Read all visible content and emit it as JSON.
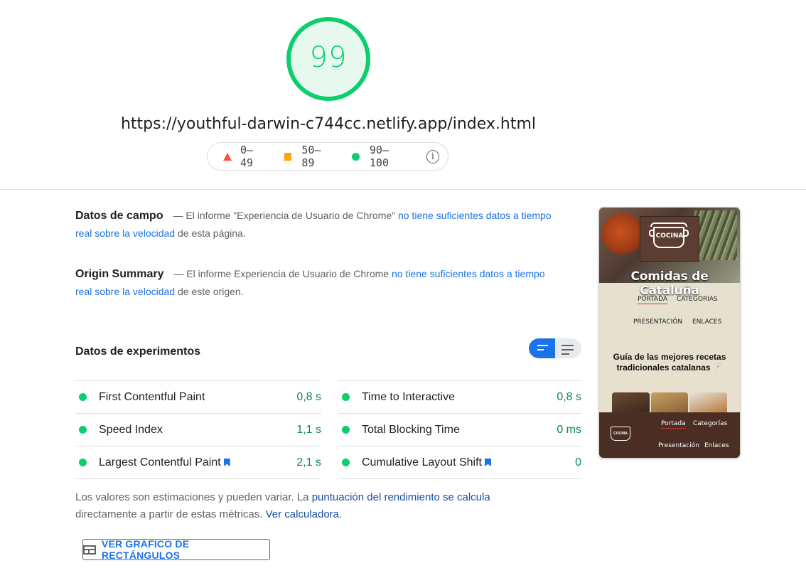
{
  "summary": {
    "score": "99",
    "url": "https://youthful-darwin-c744cc.netlify.app/index.html",
    "score_color": "#0cce6b"
  },
  "legend": {
    "fail": "0–49",
    "average": "50–89",
    "pass": "90–100",
    "info_icon": "info-icon",
    "colors": {
      "fail": "#ff4e42",
      "average": "#ffa400",
      "pass": "#0cce6b"
    }
  },
  "field_data": {
    "title": "Datos de campo",
    "dash": "—",
    "text_before": "El informe \"Experiencia de Usuario de Chrome\"",
    "link": "no tiene suficientes datos a tiempo real sobre la velocidad",
    "text_after": "de esta página."
  },
  "origin_summary": {
    "title": "Origin Summary",
    "dash": "—",
    "text_before": "El informe Experiencia de Usuario de Chrome",
    "link": "no tiene suficientes datos a tiempo real sobre la velocidad",
    "text_after": "de este origen."
  },
  "lab_data": {
    "title": "Datos de experimentos",
    "metrics_left": [
      {
        "label": "First Contentful Paint",
        "value": "0,8 s",
        "bookmark": false
      },
      {
        "label": "Speed Index",
        "value": "1,1 s",
        "bookmark": false
      },
      {
        "label": "Largest Contentful Paint",
        "value": "2,1 s",
        "bookmark": true
      }
    ],
    "metrics_right": [
      {
        "label": "Time to Interactive",
        "value": "0,8 s",
        "bookmark": false
      },
      {
        "label": "Total Blocking Time",
        "value": "0 ms",
        "bookmark": false
      },
      {
        "label": "Cumulative Layout Shift",
        "value": "0",
        "bookmark": true
      }
    ]
  },
  "note": {
    "text_before": "Los valores son estimaciones y pueden variar. La",
    "link1": "puntuación del rendimiento se calcula",
    "text_middle": "directamente a partir de estas métricas.",
    "link2": "Ver calculadora."
  },
  "treemap_button": {
    "label": "VER GRÁFICO DE RECTÁNGULOS",
    "icon": "treemap-icon"
  },
  "thumbnail": {
    "logo_text": "COCINA",
    "site_title": "Comidas de Cataluña",
    "nav": [
      "PORTADA",
      "CATEGORIAS",
      "PRESENTACIÓN",
      "ENLACES"
    ],
    "guide_title": "Guía de las mejores recetas tradicionales catalanas",
    "footer_logo_text": "COCINA",
    "footer_nav": [
      "Portada",
      "Categorías",
      "Presentación",
      "Enlaces"
    ]
  }
}
